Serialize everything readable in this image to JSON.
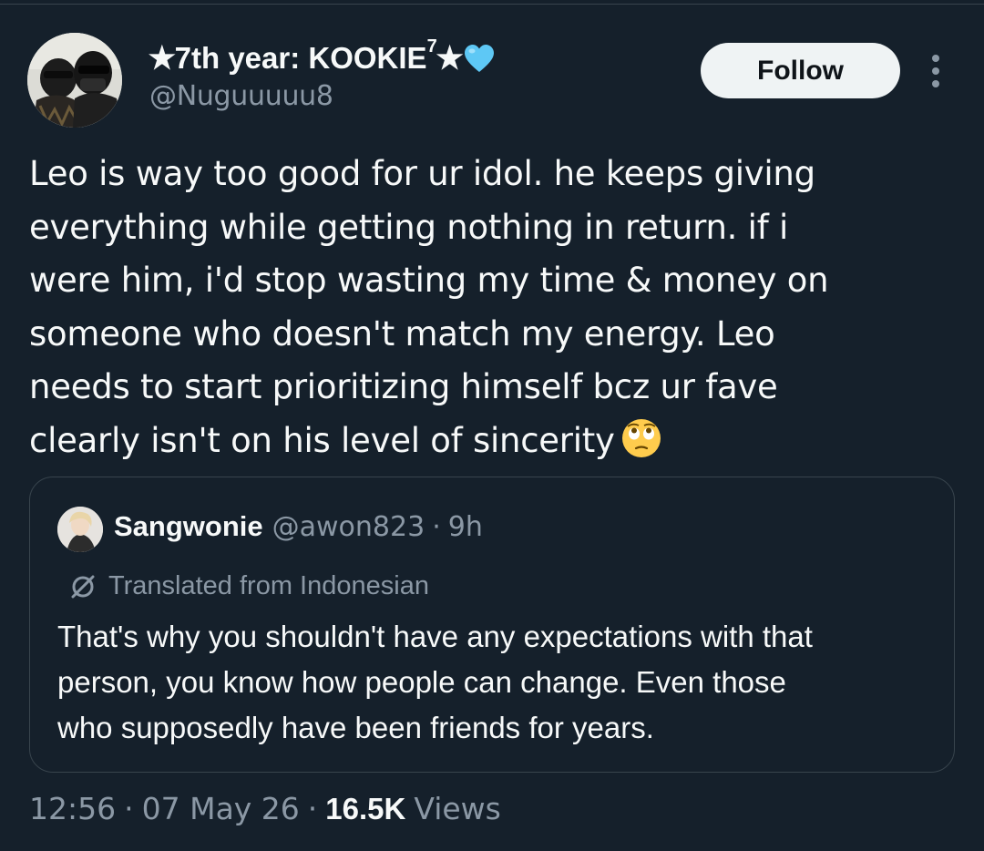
{
  "tweet": {
    "author": {
      "display_name_prefix": "✭7th year: KOOKIE",
      "display_name_sup": "7",
      "display_name_suffix": "✭",
      "heart_color": "#5ec8f5",
      "handle": "@Nuguuuuu8"
    },
    "follow_label": "Follow",
    "text": "Leo is way too good for ur idol. he keeps giving\neverything while getting nothing in return. if i\nwere him, i'd stop wasting my time & money on\nsomeone who doesn't match my energy. Leo\nneeds to start prioritizing himself bcz ur fave\nclearly isn't on his level of sincerity",
    "emoji": "face-with-rolling-eyes"
  },
  "quote": {
    "name": "Sangwonie",
    "handle": "@awon823",
    "separator": "·",
    "time": "9h",
    "translated_label": "Translated from Indonesian",
    "text": "That's why you shouldn't have any expectations with that\nperson, you know how people can change. Even those\nwho supposedly have been friends for years."
  },
  "meta": {
    "time": "12:56",
    "separator": "·",
    "date": "07 May 26",
    "views_count": "16.5K",
    "views_label": "Views"
  },
  "colors": {
    "background": "#15202b",
    "text_primary": "#f7f9f9",
    "text_secondary": "#8b98a5",
    "border": "#38444d",
    "follow_bg": "#eff3f4"
  }
}
